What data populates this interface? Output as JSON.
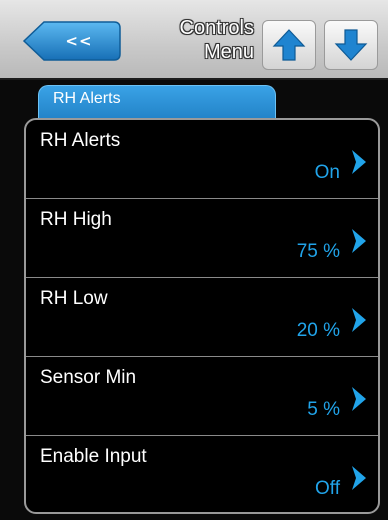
{
  "header": {
    "back_label": "<<",
    "title_line1": "Controls",
    "title_line2": "Menu"
  },
  "tab": {
    "label": "RH Alerts"
  },
  "rows": [
    {
      "label": "RH Alerts",
      "value": "On"
    },
    {
      "label": "RH High",
      "value": "75 %"
    },
    {
      "label": "RH Low",
      "value": "20 %"
    },
    {
      "label": "Sensor Min",
      "value": "5 %"
    },
    {
      "label": "Enable Input",
      "value": "Off"
    }
  ],
  "colors": {
    "accent": "#1f8fd8",
    "value_text": "#21a4ea",
    "header_bg": "#c9c9c9"
  },
  "icons": {
    "back": "back-arrow-icon",
    "up": "up-arrow-icon",
    "down": "down-arrow-icon",
    "row_arrow": "chevron-right-icon"
  }
}
